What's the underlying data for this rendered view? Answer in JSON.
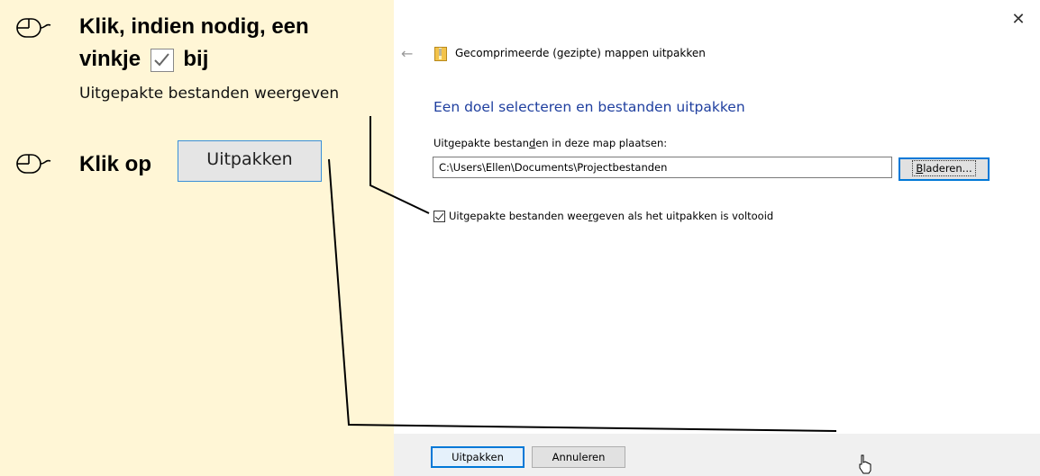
{
  "instructions": {
    "step1": {
      "line1": "Klik, indien nodig, een",
      "line2_before": "vinkje",
      "line2_after": "bij",
      "option_text": "Uitgepakte bestanden weergeven"
    },
    "step2": {
      "prefix": "Klik op",
      "button_label": "Uitpakken"
    }
  },
  "dialog": {
    "title": "Gecomprimeerde (gezipte) mappen uitpakken",
    "heading": "Een doel selecteren en bestanden uitpakken",
    "path_label_pre": "Uitgepakte bestan",
    "path_label_key": "d",
    "path_label_post": "en in deze map plaatsen:",
    "path_value": "C:\\Users\\Ellen\\Documents\\Projectbestanden",
    "browse_key": "B",
    "browse_rest": "laderen...",
    "checkbox_pre": "Uitgepakte bestanden wee",
    "checkbox_key": "r",
    "checkbox_post": "geven als het uitpakken is voltooid",
    "checkbox_checked": true,
    "extract_label": "Uitpakken",
    "cancel_label": "Annuleren",
    "close_symbol": "✕",
    "back_symbol": "←"
  },
  "colors": {
    "panel_bg": "#fff6d6",
    "heading_blue": "#1f3f9f",
    "focus_blue": "#0078d7",
    "footer_bg": "#f0f0f0"
  },
  "icons": [
    "mouse-icon",
    "zip-folder-icon",
    "back-arrow-icon",
    "close-icon",
    "checkmark-icon",
    "cursor-icon"
  ]
}
